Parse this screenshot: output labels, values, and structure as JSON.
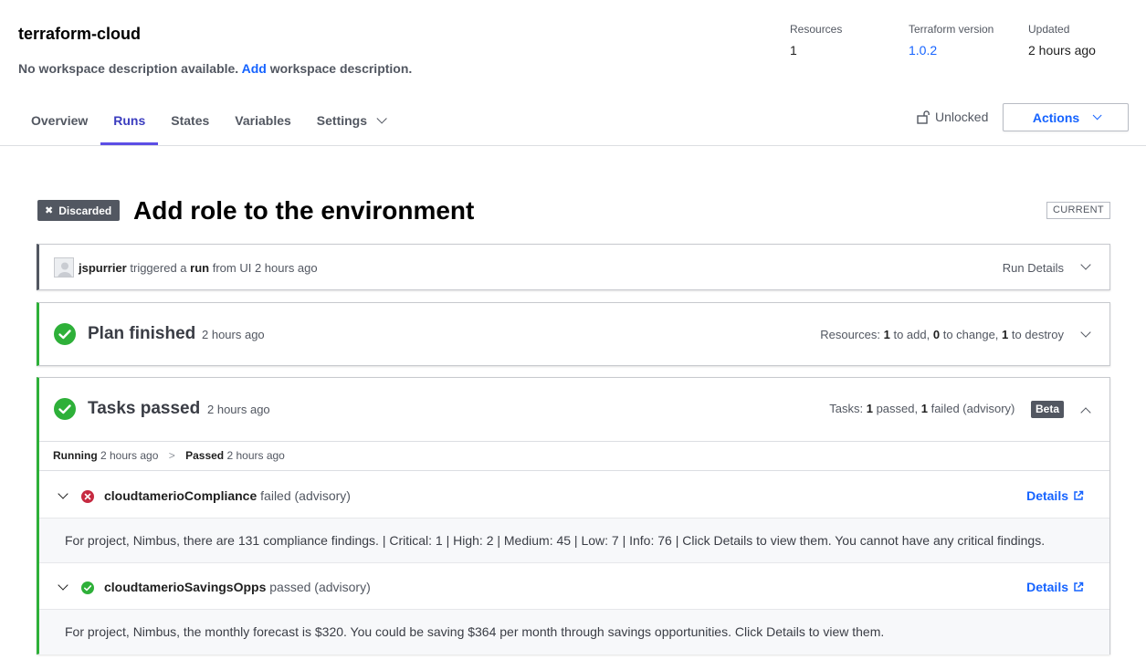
{
  "workspace": {
    "title": "terraform-cloud",
    "desc_prefix": "No workspace description available.",
    "desc_link": "Add",
    "desc_suffix": "workspace description."
  },
  "meta": {
    "resources_label": "Resources",
    "resources_value": "1",
    "version_label": "Terraform version",
    "version_value": "1.0.2",
    "updated_label": "Updated",
    "updated_value": "2 hours ago"
  },
  "tabs": [
    {
      "label": "Overview"
    },
    {
      "label": "Runs"
    },
    {
      "label": "States"
    },
    {
      "label": "Variables"
    },
    {
      "label": "Settings"
    }
  ],
  "lock_status": "Unlocked",
  "actions_label": "Actions",
  "run": {
    "status_badge": "Discarded",
    "title": "Add role to the environment",
    "current_badge": "CURRENT"
  },
  "trigger": {
    "user": "jspurrier",
    "text1": "triggered a",
    "run_word": "run",
    "text2": "from UI 2 hours ago",
    "details_label": "Run Details"
  },
  "plan": {
    "heading": "Plan finished",
    "time": "2 hours ago",
    "summary_prefix": "Resources:",
    "add_count": "1",
    "add_text": "to add,",
    "change_count": "0",
    "change_text": "to change,",
    "destroy_count": "1",
    "destroy_text": "to destroy"
  },
  "tasks": {
    "heading": "Tasks passed",
    "time": "2 hours ago",
    "summary_prefix": "Tasks:",
    "passed_count": "1",
    "passed_text": "passed,",
    "failed_count": "1",
    "failed_text": "failed (advisory)",
    "beta_badge": "Beta",
    "status_running": "Running",
    "status_running_time": "2 hours ago",
    "status_sep": ">",
    "status_passed": "Passed",
    "status_passed_time": "2 hours ago",
    "items": [
      {
        "name": "cloudtamerioCompliance",
        "result": "failed (advisory)",
        "details_label": "Details",
        "message": "For project, Nimbus, there are 131 compliance findings. | Critical: 1 | High: 2 | Medium: 45 | Low: 7 | Info: 76 | Click Details to view them. You cannot have any critical findings."
      },
      {
        "name": "cloudtamerioSavingsOpps",
        "result": "passed (advisory)",
        "details_label": "Details",
        "message": "For project, Nimbus, the monthly forecast is $320. You could be saving $364 per month through savings opportunities. Click Details to view them."
      }
    ]
  },
  "colors": {
    "accent": "#1563ff",
    "tab_active": "#5c4ee5",
    "success": "#2eb039",
    "failure": "#c62a41"
  }
}
